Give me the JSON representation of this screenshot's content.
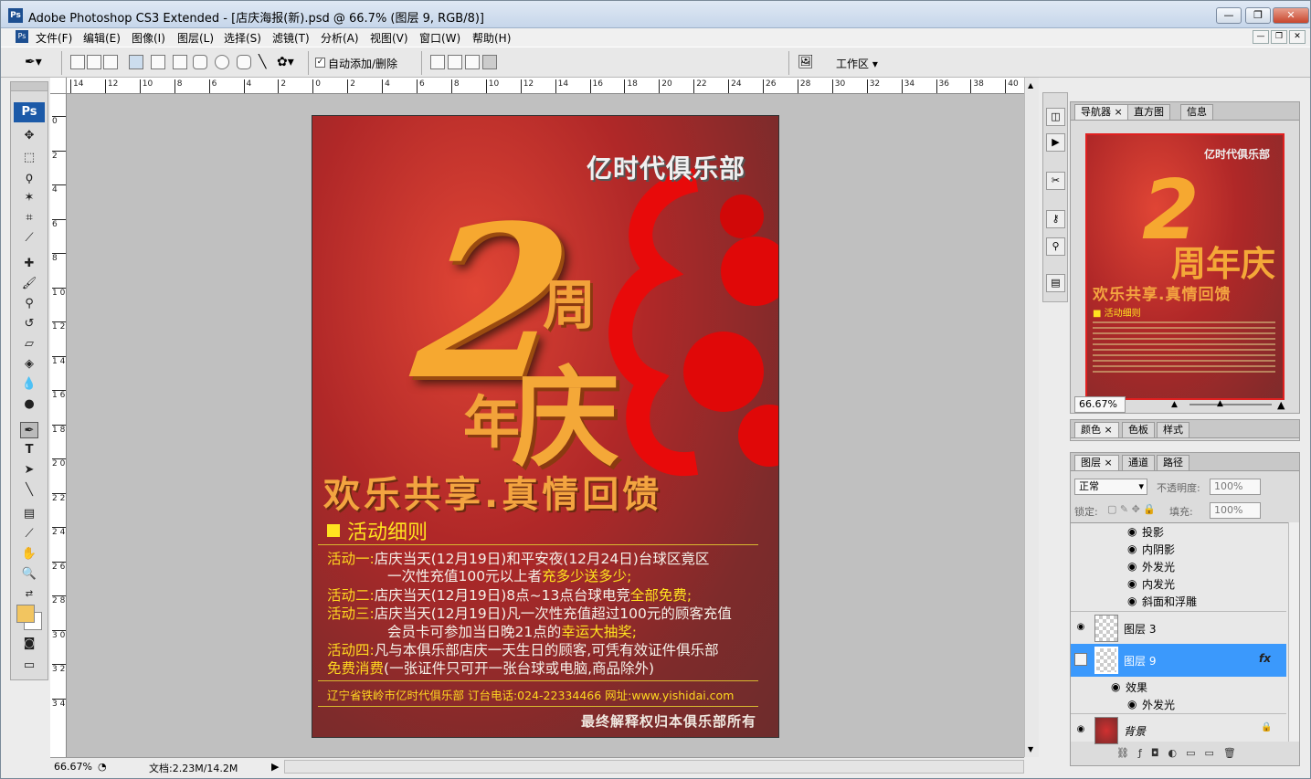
{
  "window": {
    "title": "Adobe Photoshop CS3 Extended - [店庆海报(新).psd @ 66.7% (图层 9, RGB/8)]",
    "ps_logo": "Ps"
  },
  "menu": [
    "文件(F)",
    "编辑(E)",
    "图像(I)",
    "图层(L)",
    "选择(S)",
    "滤镜(T)",
    "分析(A)",
    "视图(V)",
    "窗口(W)",
    "帮助(H)"
  ],
  "options": {
    "auto_add_delete": "自动添加/删除",
    "workspace": "工作区 ▾"
  },
  "toolbox": {
    "logo": "Ps"
  },
  "ruler": {
    "h_ticks": [
      "14",
      "12",
      "10",
      "8",
      "6",
      "4",
      "2",
      "0",
      "2",
      "4",
      "6",
      "8",
      "10",
      "12",
      "14",
      "16",
      "18",
      "20",
      "22",
      "24",
      "26",
      "28",
      "30",
      "32",
      "34",
      "36",
      "38",
      "40"
    ],
    "v_ticks": [
      "0",
      "2",
      "4",
      "6",
      "8",
      "1 0",
      "1 2",
      "1 4",
      "1 6",
      "1 8",
      "2 0",
      "2 2",
      "2 4",
      "2 6",
      "2 8",
      "3 0",
      "3 2",
      "3 4"
    ]
  },
  "poster": {
    "brand": "亿时代俱乐部",
    "big_number": "2",
    "zhou": "周",
    "nian": "年",
    "qing": "庆",
    "slogan": "欢乐共享.真情回馈",
    "section_title": "活动细则",
    "act1_label": "活动一:",
    "act1_text": "店庆当天(12月19日)和平安夜(12月24日)台球区竟区",
    "act1_line2a": "一次性充值100元以上者",
    "act1_line2b": "充多少送多少;",
    "act2_label": "活动二:",
    "act2_text": "店庆当天(12月19日)8点~13点台球电竞",
    "act2_hl": "全部免费;",
    "act3_label": "活动三:",
    "act3_text": "店庆当天(12月19日)凡一次性充值超过100元的顾客充值",
    "act3_line2a": "会员卡可参加当日晚21点的",
    "act3_line2b": "幸运大抽奖;",
    "act4_label": "活动四:",
    "act4_text": "凡与本俱乐部店庆一天生日的顾客,可凭有效证件俱乐部",
    "act4_line2a": "免费消费",
    "act4_line2b": "(一张证件只可开一张台球或电脑,商品除外)",
    "contact": "辽宁省铁岭市亿时代俱乐部 订台电话:024-22334466 网址:www.yishidai.com",
    "footer": "最终解释权归本俱乐部所有"
  },
  "statusbar": {
    "zoom": "66.67%",
    "doc_size": "文档:2.23M/14.2M"
  },
  "navigator": {
    "tabs": [
      "导航器 ×",
      "直方图",
      "信息"
    ],
    "zoom": "66.67%",
    "thumb_brand": "亿时代俱乐部",
    "thumb_2": "2",
    "thumb_qing": "周年庆",
    "thumb_slogan": "欢乐共享.真情回馈",
    "thumb_sec": "■ 活动细则"
  },
  "color_panel": {
    "tabs": [
      "颜色 ×",
      "色板",
      "样式"
    ]
  },
  "layers": {
    "tabs": [
      "图层 ×",
      "通道",
      "路径"
    ],
    "blend_mode": "正常",
    "opacity_label": "不透明度:",
    "opacity": "100%",
    "lock_label": "锁定:",
    "fill_label": "填充:",
    "fill": "100%",
    "effects_top": [
      "投影",
      "内阴影",
      "外发光",
      "内发光",
      "斜面和浮雕"
    ],
    "layer3": "图层 3",
    "layer9": "图层 9",
    "fx": "fx",
    "effects_label": "效果",
    "outer_glow": "外发光",
    "background": "背景"
  }
}
